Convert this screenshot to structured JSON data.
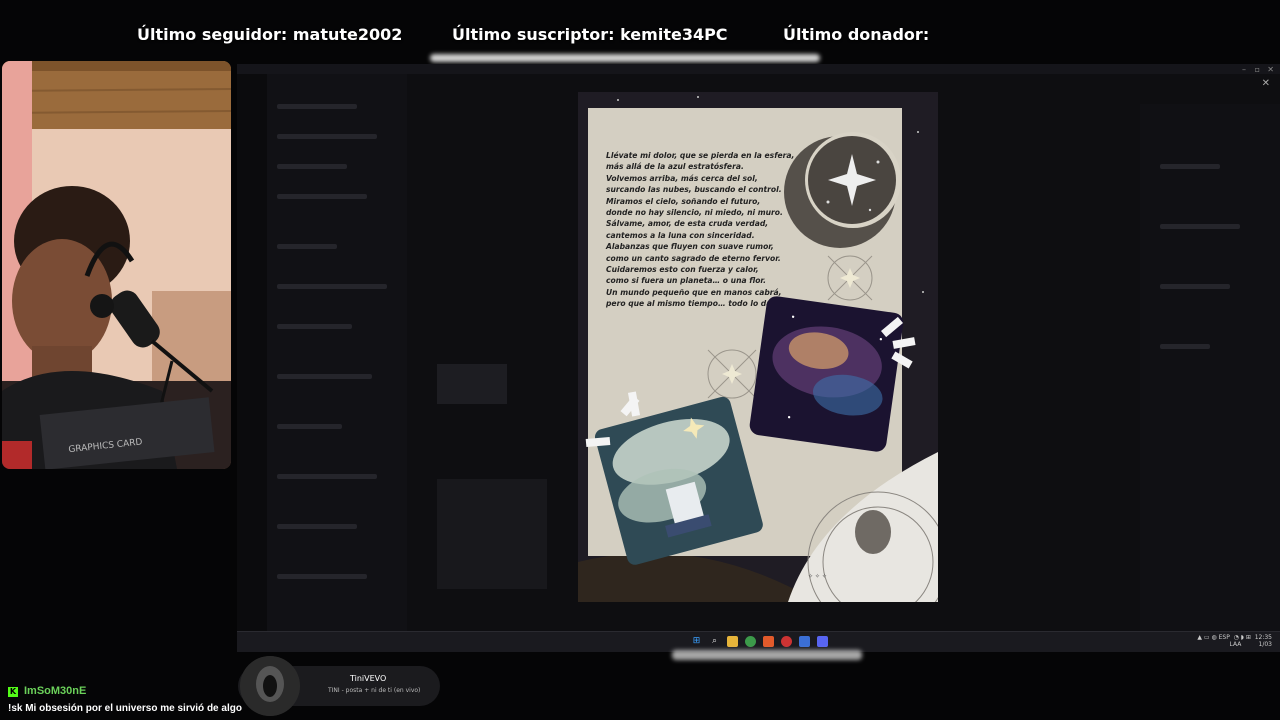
{
  "overlay": {
    "follower_text": "Último seguidor: matute2002",
    "subscriber_text": "Último suscriptor: kemite34PC",
    "donor_text": "Último donador:"
  },
  "poem": {
    "lines": [
      "Llévate mi dolor, que se pierda en la esfera,",
      "más allá de la azul estratósfera.",
      "Volvemos arriba, más cerca del sol,",
      "surcando las nubes, buscando el control.",
      "Miramos el cielo, soñando el futuro,",
      "donde no hay silencio, ni miedo, ni muro.",
      "Sálvame, amor, de esta cruda verdad,",
      "cantemos a la luna con sinceridad.",
      "Alabanzas que fluyen con suave rumor,",
      "como un canto sagrado de eterno fervor.",
      "Cuidaremos esto con fuerza y calor,",
      "como si fuera un planeta… o una flor.",
      "Un mundo pequeño que en manos cabrá,",
      "pero que al mismo tiempo… todo lo dará."
    ]
  },
  "chat": {
    "username": "ImSoM30nE",
    "message": "!sk Mi obsesión por el universo me sirvió de algo"
  },
  "now_playing": {
    "artist": "TiniVEVO",
    "track": "TINI - posta + ni de ti (en vivo)"
  },
  "icons": {
    "chat_badge": "kick-icon",
    "window_close": "close-icon"
  },
  "colors": {
    "chat_username": "#6bd15a",
    "paper": "#d9d4c8",
    "background": "#050506"
  }
}
